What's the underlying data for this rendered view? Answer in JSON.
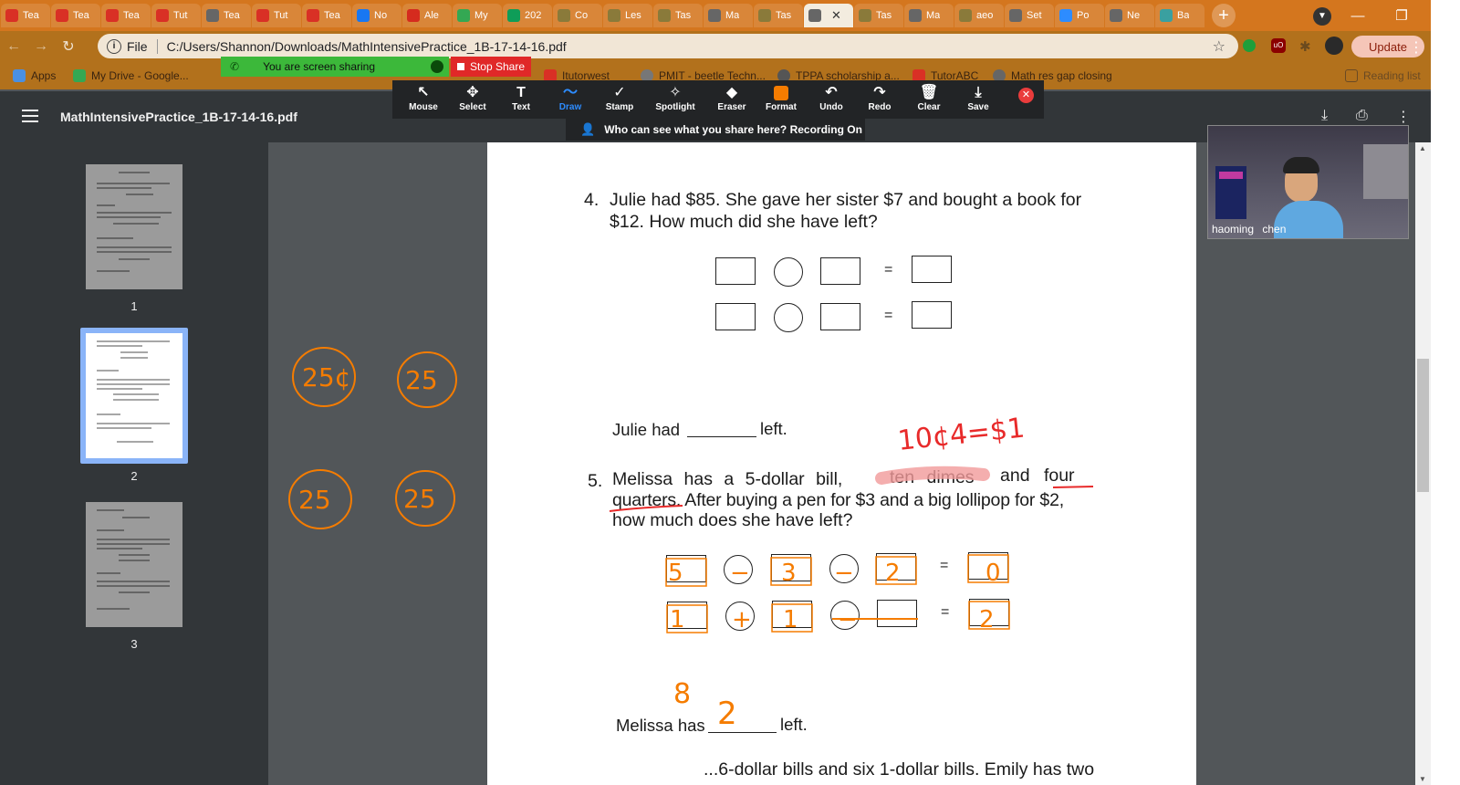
{
  "browser": {
    "tabs": [
      {
        "label": "Tea",
        "icon": "i-logo-icon",
        "color": "#d93025"
      },
      {
        "label": "Tea",
        "icon": "i-logo-icon",
        "color": "#d93025"
      },
      {
        "label": "Tea",
        "icon": "i-logo-icon",
        "color": "#d93025"
      },
      {
        "label": "Tut",
        "icon": "i-logo-icon",
        "color": "#d93025"
      },
      {
        "label": "Tea",
        "icon": "globe-icon",
        "color": "#666666"
      },
      {
        "label": "Tut",
        "icon": "i-logo-icon",
        "color": "#d93025"
      },
      {
        "label": "Tea",
        "icon": "i-logo-icon",
        "color": "#d93025"
      },
      {
        "label": "No",
        "icon": "facebook-icon",
        "color": "#1877f2"
      },
      {
        "label": "Ale",
        "icon": "maple-leaf-icon",
        "color": "#d52b1e"
      },
      {
        "label": "My",
        "icon": "drive-icon",
        "color": "#34a853"
      },
      {
        "label": "202",
        "icon": "sheets-icon",
        "color": "#0f9d58"
      },
      {
        "label": "Co",
        "icon": "doc-icon",
        "color": "#8a7a3a"
      },
      {
        "label": "Les",
        "icon": "doc-icon",
        "color": "#8a7a3a"
      },
      {
        "label": "Tas",
        "icon": "doc-icon",
        "color": "#8a7a3a"
      },
      {
        "label": "Ma",
        "icon": "globe-icon",
        "color": "#666666"
      },
      {
        "label": "Tas",
        "icon": "doc-icon",
        "color": "#8a7a3a"
      },
      {
        "label": "",
        "icon": "globe-icon",
        "color": "#666666",
        "active": true
      },
      {
        "label": "Tas",
        "icon": "doc-icon",
        "color": "#8a7a3a"
      },
      {
        "label": "Ma",
        "icon": "globe-icon",
        "color": "#666666"
      },
      {
        "label": "aeo",
        "icon": "doc-icon",
        "color": "#8a7a3a"
      },
      {
        "label": "Set",
        "icon": "gear-icon",
        "color": "#666666"
      },
      {
        "label": "Po",
        "icon": "zoom-icon",
        "color": "#2d8cff"
      },
      {
        "label": "Ne",
        "icon": "globe-icon",
        "color": "#666666"
      },
      {
        "label": "Ba",
        "icon": "bot-icon",
        "color": "#3aa0a0"
      }
    ],
    "url_scheme": "File",
    "url": "C:/Users/Shannon/Downloads/MathIntensivePractice_1B-17-14-16.pdf",
    "update_label": "Update",
    "bookmarks": [
      "Apps",
      "My Drive - Google...",
      "Itutorwest",
      "PMIT - beetle Techn...",
      "TPPA scholarship a...",
      "TutorABC",
      "Math res gap closing",
      "Reading list"
    ]
  },
  "zoom": {
    "sharing_label": "You are screen sharing",
    "stop_share_label": "Stop Share",
    "tools": [
      "Mouse",
      "Select",
      "Text",
      "Draw",
      "Stamp",
      "Spotlight",
      "Eraser",
      "Format",
      "Undo",
      "Redo",
      "Clear",
      "Save"
    ],
    "selected_tool": "Draw",
    "who_can_see": "Who can see what you share here? Recording On",
    "participant_name": "haoming chen"
  },
  "pdf": {
    "title": "MathIntensivePractice_1B-17-14-16.pdf",
    "pages": [
      "1",
      "2",
      "3"
    ],
    "current_page": "2",
    "q4_num": "4.",
    "q4_line1": "Julie had $85. She gave her sister $7 and bought a book for",
    "q4_line2": "$12. How much did she have left?",
    "eq_sign": "=",
    "q4_answer_prefix": "Julie had",
    "q4_answer_suffix": "left.",
    "q5_num": "5.",
    "q5_line1_a": "Melissa has a 5-dollar bill,",
    "q5_line1_b": "ten dimes",
    "q5_line1_c": "and four",
    "q5_line2": "quarters. After buying a pen for $3 and a big lollipop for $2,",
    "q5_line3": "how much does she have left?",
    "q5_answer_prefix": "Melissa has",
    "q5_answer_suffix": "left.",
    "q6_partial": "...6-dollar bills and six 1-dollar bills. Emily has two"
  },
  "handwriting": {
    "red_note": "10¢4=$1",
    "q5_row1": [
      "5",
      "−",
      "3",
      "−",
      "2",
      "=",
      "0"
    ],
    "q5_row2": [
      "1",
      "+",
      "1",
      "−",
      "",
      "=",
      "2"
    ],
    "q5_scratch": "8",
    "q5_answer": "2",
    "coins": [
      "25¢",
      "25",
      "25",
      "25"
    ],
    "ink_color": "#f57c00",
    "red_ink_color": "#e82a2a"
  }
}
